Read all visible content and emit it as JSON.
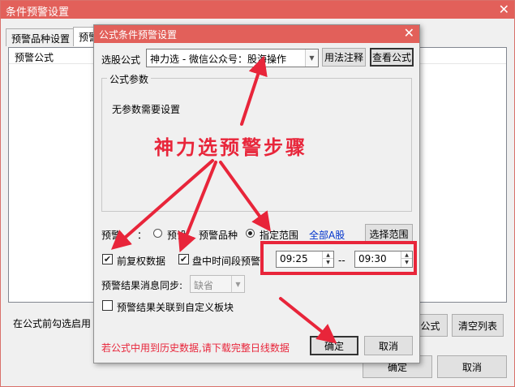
{
  "outer": {
    "title": "条件预警设置",
    "close_glyph": "✕",
    "tabs": [
      {
        "label": "预警品种设置"
      },
      {
        "label": "预警"
      }
    ],
    "list_header": "预警公式",
    "bottom_text": "在公式前勾选启用",
    "formula_button": "公式",
    "clear_button": "清空列表",
    "ok_button": "确定",
    "cancel_button": "取消"
  },
  "dialog": {
    "title": "公式条件预警设置",
    "close_glyph": "✕",
    "select_formula_label": "选股公式",
    "formula_value": "神力选      - 微信公众号：股海操作",
    "usage_button": "用法注释",
    "view_button": "查看公式",
    "params_group_title": "公式参数",
    "no_params_text": "无参数需要设置",
    "range_label": "预警",
    "range_label_tail": "：",
    "radio_preset_label": "预设",
    "radio_preset_tail": "预警品种",
    "radio_specified_label": "指定范围",
    "all_a_link": "全部A股",
    "choose_range_button": "选择范围",
    "rehab_check_label": "前复权数据",
    "intraday_check_label": "盘中时间段预警",
    "check_glyph": "✔",
    "time_start": "09:25",
    "time_sep": "--",
    "time_end": "09:30",
    "sync_label": "预警结果消息同步:",
    "sync_value": "缺省",
    "link_block_label": "预警结果关联到自定义板块",
    "warning_text": "若公式中用到历史数据,请下载完整日线数据",
    "ok_button": "确定",
    "cancel_button": "取消"
  },
  "annotation": {
    "text": "神力选预警步骤",
    "color": "#e8253a"
  },
  "colors": {
    "title_bar": "#e2605a",
    "link_blue": "#0033cc",
    "warning_red": "#e8253a"
  }
}
